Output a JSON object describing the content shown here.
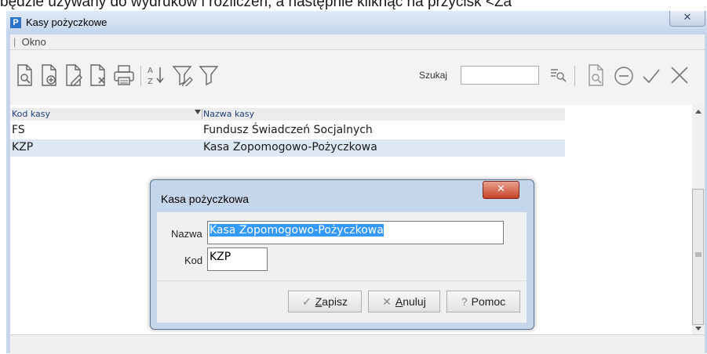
{
  "doc_text": "będzie używany do wydruków i rozliczeń, a następnie kliknąć na przycisk <Za",
  "window": {
    "title": "Kasy pożyczkowe",
    "close_glyph": "✕"
  },
  "menu": {
    "okno": "Okno"
  },
  "toolbar": {
    "search_label": "Szukaj",
    "search_value": ""
  },
  "grid": {
    "columns": [
      "Kod kasy",
      "Nazwa kasy"
    ],
    "rows": [
      {
        "code": "FS",
        "name": "Fundusz Świadczeń Socjalnych"
      },
      {
        "code": "KZP",
        "name": "Kasa Zopomogowo-Pożyczkowa"
      }
    ]
  },
  "dialog": {
    "title": "Kasa pożyczkowa",
    "close_glyph": "✕",
    "name_label": "Nazwa",
    "name_value": "Kasa Zopomogowo-Pożyczkowa",
    "code_label": "Kod",
    "code_value": "KZP",
    "save_mnemonic": "Z",
    "save_rest": "apisz",
    "cancel_mnemonic": "A",
    "cancel_rest": "nuluj",
    "help_label": "Pomoc"
  },
  "icons": [
    "preview-icon",
    "add-icon",
    "edit-icon",
    "delete-icon",
    "print-icon",
    "sort-icon",
    "filter-edit-icon",
    "filter-icon",
    "search-icon",
    "preview-icon",
    "minus-circle-icon",
    "check-icon",
    "close-icon"
  ],
  "colors": {
    "selection": "#3399ff",
    "row_highlight": "#dde8f3",
    "window_frame": "#c5d6ea"
  }
}
